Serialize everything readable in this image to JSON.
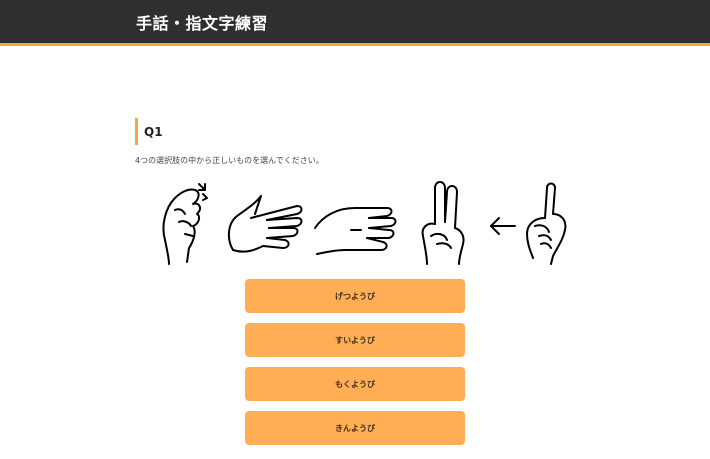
{
  "header": {
    "title": "手話・指文字練習"
  },
  "question": {
    "number": "Q1",
    "instruction": "4つの選択肢の中から正しいものを選んでください。",
    "sign_images": [
      "hand-sign-1",
      "hand-sign-2",
      "hand-sign-3",
      "hand-sign-4",
      "arrow-left-icon",
      "hand-sign-5"
    ]
  },
  "options": [
    "げつようび",
    "すいようび",
    "もくようび",
    "きんようび"
  ],
  "colors": {
    "accent": "#f7a541",
    "header_bg": "#2f2f2f",
    "button_bg": "#ffae56"
  }
}
